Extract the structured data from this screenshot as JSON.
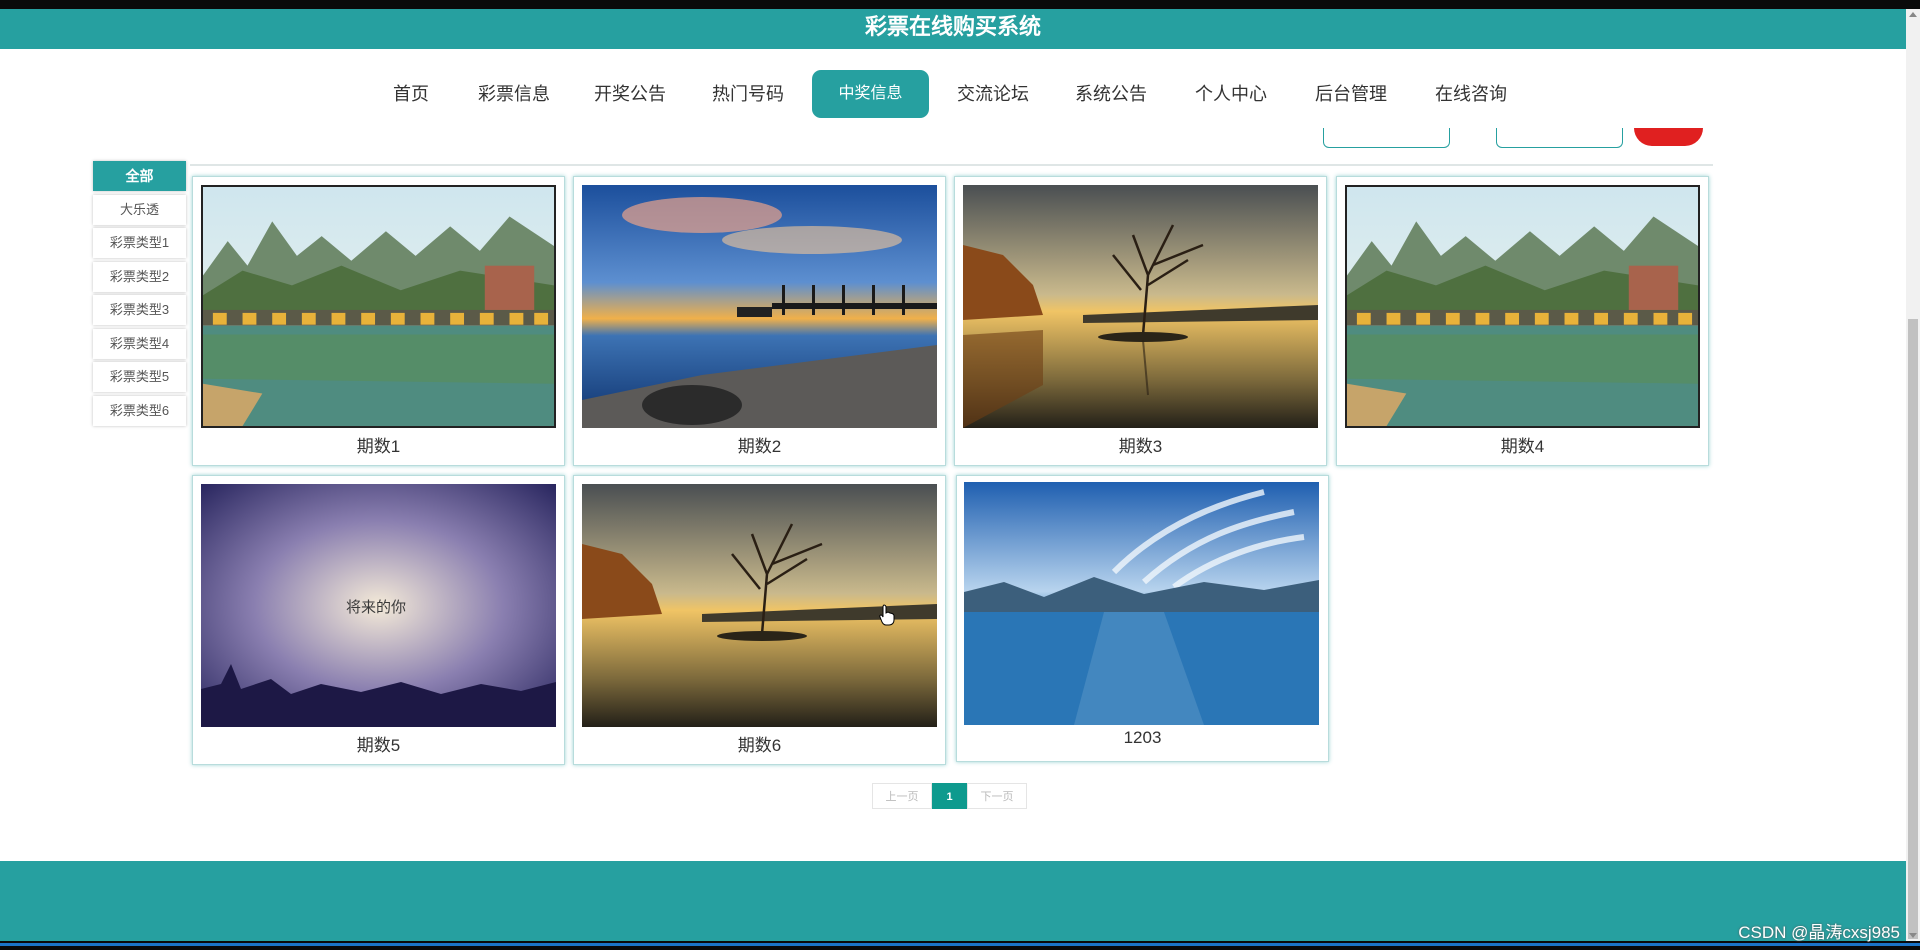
{
  "app": {
    "title": "彩票在线购买系统"
  },
  "nav": {
    "items": [
      {
        "label": "首页"
      },
      {
        "label": "彩票信息"
      },
      {
        "label": "开奖公告"
      },
      {
        "label": "热门号码"
      },
      {
        "label": "中奖信息"
      },
      {
        "label": "交流论坛"
      },
      {
        "label": "系统公告"
      },
      {
        "label": "个人中心"
      },
      {
        "label": "后台管理"
      },
      {
        "label": "在线咨询"
      }
    ],
    "active": "中奖信息"
  },
  "sidebar": {
    "items": [
      {
        "label": "全部"
      },
      {
        "label": "大乐透"
      },
      {
        "label": "彩票类型1"
      },
      {
        "label": "彩票类型2"
      },
      {
        "label": "彩票类型3"
      },
      {
        "label": "彩票类型4"
      },
      {
        "label": "彩票类型5"
      },
      {
        "label": "彩票类型6"
      }
    ],
    "active": "全部"
  },
  "cards": [
    {
      "caption": "期数1",
      "scene": "bridge-lake-mountains"
    },
    {
      "caption": "期数2",
      "scene": "sunset-pier"
    },
    {
      "caption": "期数3",
      "scene": "lone-tree-lake"
    },
    {
      "caption": "期数4",
      "scene": "bridge-lake-mountains"
    },
    {
      "caption": "期数5",
      "scene": "purple-sky-text",
      "overlay_text": "将来的你"
    },
    {
      "caption": "期数6",
      "scene": "lone-tree-lake"
    },
    {
      "caption": "1203",
      "scene": "blue-lake-mountains"
    }
  ],
  "pager": {
    "prev": "上一页",
    "current": "1",
    "next": "下一页"
  },
  "watermark": "CSDN @晶涛cxsj985",
  "colors": {
    "accent": "#26a0a0",
    "pager_active": "#0e9a8e",
    "alert": "#e02020"
  }
}
